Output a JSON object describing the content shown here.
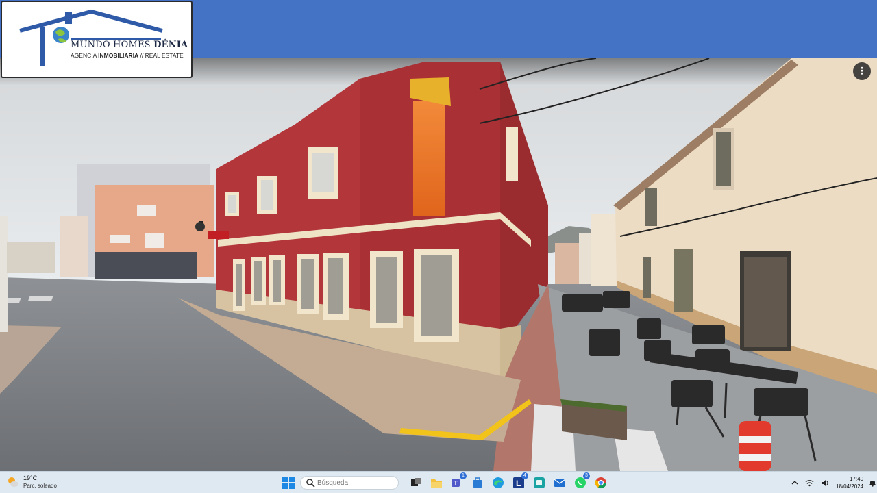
{
  "header": {
    "color": "#4472c4",
    "logo": {
      "brand_main": "MUNDO HOMES",
      "brand_accent": "DÉNIA",
      "tagline_prefix": "AGENCIA",
      "tagline_bold": "INMOBILIARIA",
      "tagline_suffix": "// REAL ESTATE"
    }
  },
  "street_view": {
    "menu_icon": "vertical-dots-icon"
  },
  "taskbar": {
    "weather": {
      "temperature": "19°C",
      "condition": "Parc. soleado",
      "icon": "sun-cloud-icon"
    },
    "search": {
      "placeholder": "Búsqueda"
    },
    "apps": [
      {
        "name": "start",
        "icon": "windows-icon"
      },
      {
        "name": "task-view",
        "icon": "task-view-icon"
      },
      {
        "name": "file-explorer",
        "icon": "folder-icon"
      },
      {
        "name": "teams",
        "icon": "teams-icon",
        "badge": "1"
      },
      {
        "name": "store",
        "icon": "store-icon"
      },
      {
        "name": "edge",
        "icon": "edge-icon"
      },
      {
        "name": "app-l",
        "icon": "l-app-icon",
        "badge": "4"
      },
      {
        "name": "app-teal",
        "icon": "teal-app-icon"
      },
      {
        "name": "mail",
        "icon": "mail-icon"
      },
      {
        "name": "whatsapp",
        "icon": "whatsapp-icon",
        "badge": "3"
      },
      {
        "name": "chrome",
        "icon": "chrome-icon"
      }
    ],
    "clock": {
      "time": "17:40",
      "date": "18/04/2024"
    }
  }
}
